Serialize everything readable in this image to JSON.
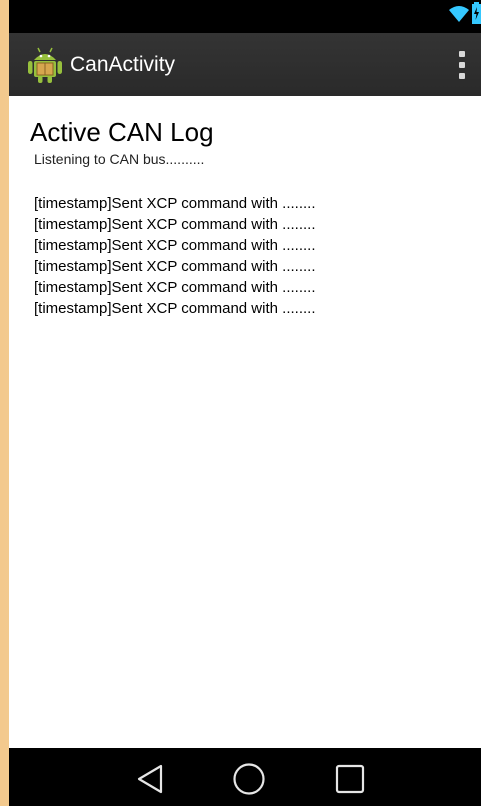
{
  "status_bar": {
    "icons": [
      "wifi-icon",
      "battery-charging-icon"
    ]
  },
  "action_bar": {
    "icon": "android-app-icon",
    "title": "CanActivity",
    "menu_icon": "overflow-menu-icon"
  },
  "content": {
    "title": "Active CAN Log",
    "status": "Listening to CAN bus..........",
    "log_entries": [
      "[timestamp]Sent XCP command with ........",
      "[timestamp]Sent XCP command with ........",
      "[timestamp]Sent XCP command with ........",
      "[timestamp]Sent XCP command with ........",
      "[timestamp]Sent XCP command with ........",
      "[timestamp]Sent XCP command with ........"
    ]
  },
  "nav_bar": {
    "buttons": [
      "back-icon",
      "home-icon",
      "recent-apps-icon"
    ]
  },
  "colors": {
    "status_bar_bg": "#000000",
    "action_bar_bg": "#2f2f2f",
    "accent": "#2ec4ff",
    "android_green": "#97c03d"
  }
}
